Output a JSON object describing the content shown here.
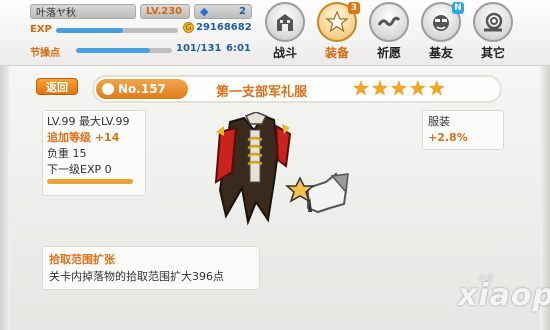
{
  "status": {
    "player_name": "叶落ヤ秋",
    "level": "LV.230",
    "gem_count": "2",
    "exp_label": "EXP",
    "exp_progress": 0.55,
    "gold": "29168682",
    "stamina_label": "节操点",
    "stamina_value": "101/131",
    "stamina_progress": 0.77,
    "timer": "6:01"
  },
  "nav": {
    "items": [
      {
        "label": "战斗",
        "icon": "building-icon",
        "active": false,
        "badge": ""
      },
      {
        "label": "装备",
        "icon": "star-icon",
        "active": true,
        "badge": "3"
      },
      {
        "label": "祈愿",
        "icon": "wave-icon",
        "active": false,
        "badge": ""
      },
      {
        "label": "基友",
        "icon": "friend-face-icon",
        "active": false,
        "badge": "N"
      },
      {
        "label": "其它",
        "icon": "snail-icon",
        "active": false,
        "badge": ""
      }
    ]
  },
  "detail": {
    "back_label": "返回",
    "number": "No.157",
    "name": "第一支部军礼服",
    "stars": 5,
    "stats": {
      "level_line": "LV.99 最大LV.99",
      "bonus_line": "追加等级 +14",
      "weight_line": "负重 15",
      "next_exp_line": "下一级EXP 0",
      "next_exp_progress": 1.0
    },
    "attribute": {
      "name": "服装",
      "value": "+2.8%"
    },
    "skill": {
      "name": "拾取范围扩张",
      "description": "关卡内掉落物的拾取范围扩大396点"
    }
  },
  "colors": {
    "accent": "#e0701a",
    "exp_bar": "#4a9fe0",
    "star": "#f2a51d"
  },
  "watermark": {
    "main": "xiaopi",
    "small": "小皮"
  }
}
